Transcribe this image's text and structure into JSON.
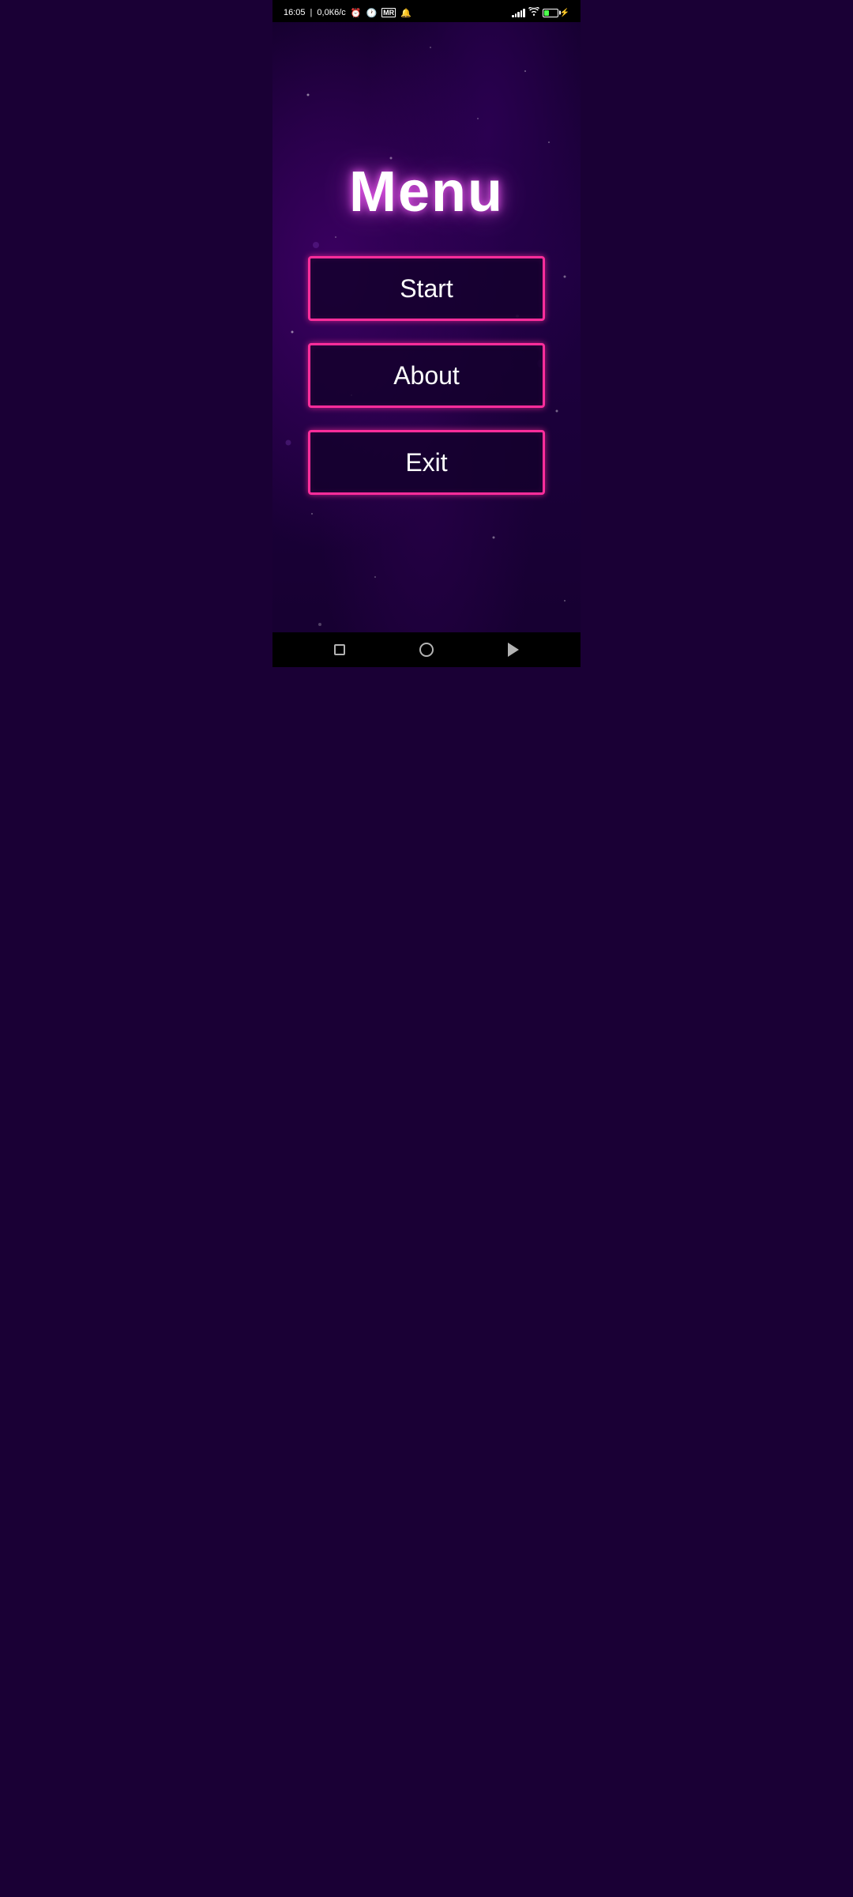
{
  "status_bar": {
    "time": "16:05",
    "data_speed": "0,0К6/с",
    "battery_level": "39",
    "battery_charging": true
  },
  "header": {
    "title": "Menu"
  },
  "buttons": [
    {
      "id": "start",
      "label": "Start"
    },
    {
      "id": "about",
      "label": "About"
    },
    {
      "id": "exit",
      "label": "Exit"
    }
  ],
  "nav_bar": {
    "square_label": "recent-apps",
    "circle_label": "home",
    "triangle_label": "back"
  },
  "colors": {
    "background_deep": "#12002a",
    "background_mid": "#1e0040",
    "accent_pink": "#ff2d9b",
    "button_bg": "rgba(20,0,45,0.85)",
    "title_white": "#ffffff"
  }
}
